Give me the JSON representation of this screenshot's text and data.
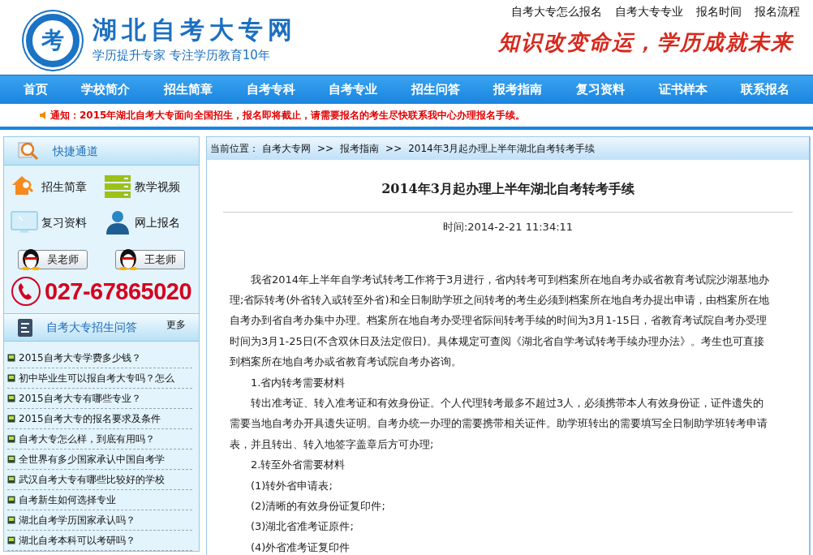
{
  "header": {
    "logo_mark": "考",
    "site_name": "湖北自考大专网",
    "tagline": "学历提升专家 专注学历教育10年",
    "top_links": [
      "自考大专怎么报名",
      "自考大专专业",
      "报名时间",
      "报名流程"
    ],
    "slogan": "知识改变命运，学历成就未来"
  },
  "nav": [
    "首页",
    "学校简介",
    "招生简章",
    "自考专科",
    "自考专业",
    "招生问答",
    "报考指南",
    "复习资料",
    "证书样本",
    "联系报名"
  ],
  "notice": "通知：2015年湖北自考大专面向全国招生，报名即将截止，请需要报名的考生尽快联系我中心办理报名手续。",
  "quick": {
    "title": "快捷通道",
    "links": [
      {
        "label": "招生简章",
        "kind": "house"
      },
      {
        "label": "教学视频",
        "kind": "server"
      },
      {
        "label": "复习资料",
        "kind": "monitor"
      },
      {
        "label": "网上报名",
        "kind": "person"
      }
    ],
    "teachers": [
      "吴老师",
      "王老师"
    ],
    "phone": "027-67865020"
  },
  "faq": {
    "title": "自考大专招生问答",
    "more": "更多",
    "items": [
      "2015自考大专学费多少钱？",
      "初中毕业生可以报自考大专吗？怎么",
      "2015自考大专有哪些专业？",
      "2015自考大专的报名要求及条件",
      "自考大专怎么样，到底有用吗？",
      "全世界有多少国家承认中国自考学",
      "武汉自考大专有哪些比较好的学校",
      "自考新生如何选择专业",
      "湖北自考学历国家承认吗？",
      "湖北自考本科可以考研吗？"
    ]
  },
  "article": {
    "breadcrumb_prefix": "当前位置：",
    "breadcrumb": [
      {
        "label": "自考大专网",
        "kind": "link"
      },
      {
        "label": ">>",
        "kind": "separator"
      },
      {
        "label": "报考指南",
        "kind": "link"
      },
      {
        "label": ">>",
        "kind": "separator"
      },
      {
        "label": "2014年3月起办理上半年湖北自考转考手续",
        "kind": "current"
      }
    ],
    "title": "2014年3月起办理上半年湖北自考转考手续",
    "time": "时间:2014-2-21 11:34:11",
    "paragraphs": [
      "我省2014年上半年自学考试转考工作将于3月进行，省内转考可到档案所在地自考办或省教育考试院沙湖基地办理;省际转考(外省转入或转至外省)和全日制助学班之间转考的考生必须到档案所在地自考办提出申请，由档案所在地自考办到省自考办集中办理。档案所在地自考办受理省际间转考手续的时间为3月1-15日，省教育考试院自考办受理时间为3月1-25日(不含双休日及法定假日)。具体规定可查阅《湖北省自学考试转考手续办理办法》。考生也可直接到档案所在地自考办或省教育考试院自考办咨询。",
      "1.省内转考需要材料",
      "转出准考证、转入准考证和有效身份证。个人代理转考最多不超过3人，必须携带本人有效身份证，证件遗失的需要当地自考办开具遗失证明。自考办统一办理的需要携带相关证件。助学班转出的需要填写全日制助学班转考申请表，并且转出、转入地签字盖章后方可办理;",
      "2.转至外省需要材料",
      "(1)转外省申请表;",
      "(2)清晰的有效身份证复印件;",
      "(3)湖北省准考证原件;",
      "(4)外省准考证复印件"
    ]
  }
}
